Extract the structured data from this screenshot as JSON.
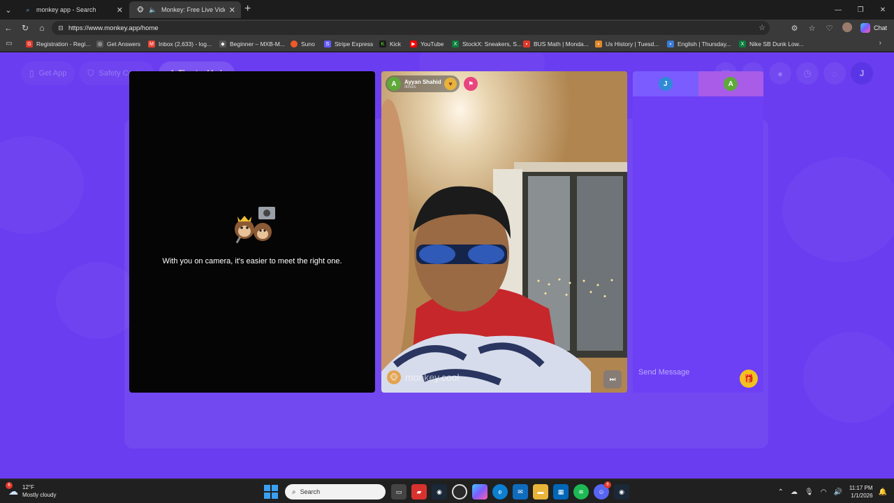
{
  "browser": {
    "tabs": [
      {
        "title": "monkey app - Search",
        "icon": "search-icon"
      },
      {
        "title": "Monkey: Free Live Video Chat",
        "icon": "monkey-icon"
      }
    ],
    "url": "https://www.monkey.app/home",
    "chat_label": "Chat",
    "bookmarks": [
      {
        "label": "Registration - Regi...",
        "color": "#e0392b"
      },
      {
        "label": "Get Answers",
        "color": "#555555"
      },
      {
        "label": "Inbox (2,633) - log...",
        "color": "#ea4335"
      },
      {
        "label": "Beginner – MXB-M...",
        "color": "#555555"
      },
      {
        "label": "Suno",
        "color": "#f05a28"
      },
      {
        "label": "Stripe Express",
        "color": "#635bff"
      },
      {
        "label": "Kick",
        "color": "#53fc18"
      },
      {
        "label": "YouTube",
        "color": "#ff0000"
      },
      {
        "label": "StockX: Sneakers, S...",
        "color": "#0a7d3b"
      },
      {
        "label": "BUS Math | Monda...",
        "color": "#e0392b"
      },
      {
        "label": "Us History | Tuesd...",
        "color": "#e08a2b"
      },
      {
        "label": "English | Thursday...",
        "color": "#3a7bd5"
      },
      {
        "label": "Nike SB Dunk Low...",
        "color": "#0a7d3b"
      }
    ]
  },
  "app": {
    "nav": {
      "get_app": "Get App",
      "safety_center": "Safety Center",
      "theater_mode": "Theater Mode"
    },
    "right_nav": {
      "avatar_letter": "J"
    },
    "self_panel": {
      "prompt": "With you on camera, it's easier to meet the right one."
    },
    "partner": {
      "name": "Ayyan Shahid",
      "location": "Illinois",
      "avatar_letter": "A",
      "watermark": "monkey.cool"
    },
    "chat": {
      "tab_a_letter": "J",
      "tab_b_letter": "A",
      "placeholder": "Send Message"
    }
  },
  "taskbar": {
    "weather_temp": "12°F",
    "weather_desc": "Mostly cloudy",
    "weather_badge": "6",
    "search_placeholder": "Search",
    "discord_badge": "6",
    "time": "11:17 PM",
    "date": "1/1/2026"
  },
  "colors": {
    "page_bg": "#6a3df0",
    "chat_tab_a": "#7b5cff",
    "chat_tab_b": "#a85ce8",
    "partner_avatar": "#5fa83a",
    "gift": "#f4c21c"
  }
}
